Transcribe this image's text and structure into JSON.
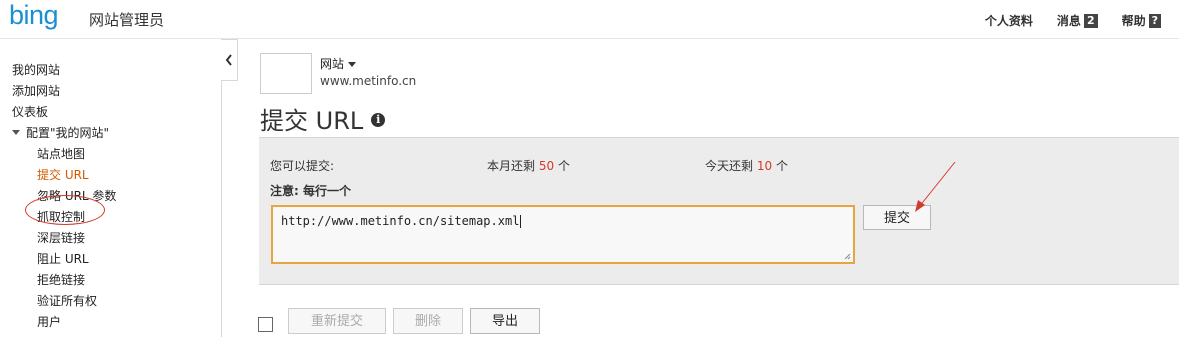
{
  "header": {
    "logo_text": "bing",
    "app_name": "网站管理员",
    "nav": [
      {
        "label": "个人资料"
      },
      {
        "label": "消息",
        "badge": "2"
      },
      {
        "label": "帮助",
        "badge": "?"
      }
    ]
  },
  "sidebar": {
    "items": [
      {
        "label": "我的网站"
      },
      {
        "label": "添加网站"
      },
      {
        "label": "仪表板"
      },
      {
        "label": "配置\"我的网站\""
      },
      {
        "label": "站点地图"
      },
      {
        "label": "提交 URL"
      },
      {
        "label": "忽略 URL 参数"
      },
      {
        "label": "抓取控制"
      },
      {
        "label": "深层链接"
      },
      {
        "label": "阻止 URL"
      },
      {
        "label": "拒绝链接"
      },
      {
        "label": "验证所有权"
      },
      {
        "label": "用户"
      }
    ]
  },
  "site": {
    "label": "网站",
    "url": "www.metinfo.cn"
  },
  "page_title": "提交 URL",
  "submit_panel": {
    "can_submit_label": "您可以提交:",
    "month_prefix": "本月还剩",
    "month_count": "50",
    "month_suffix": "个",
    "today_prefix": "今天还剩",
    "today_count": "10",
    "today_suffix": "个",
    "note": "注意: 每行一个",
    "url_value": "http://www.metinfo.cn/sitemap.xml",
    "submit_label": "提交"
  },
  "toolbar": {
    "resubmit_label": "重新提交",
    "delete_label": "删除",
    "export_label": "导出"
  },
  "colors": {
    "brand": "#1a8fd1",
    "active_nav": "#d25a00",
    "annotation": "#d23a2a",
    "input_border": "#e8a441"
  }
}
